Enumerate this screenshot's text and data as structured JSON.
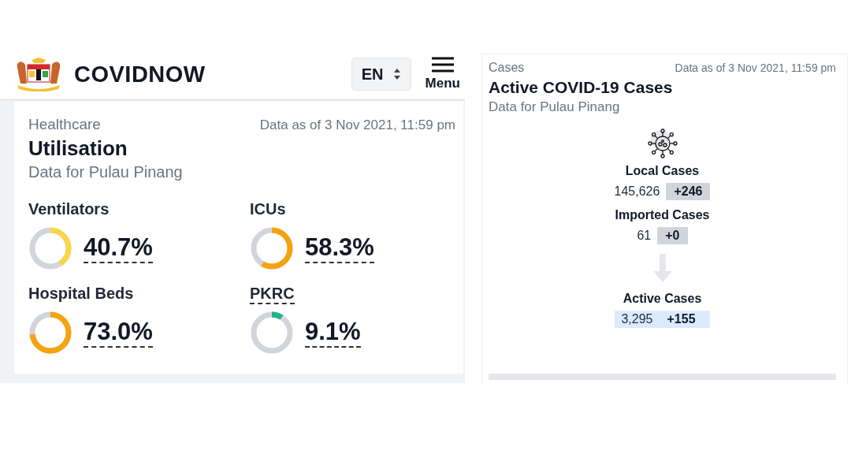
{
  "header": {
    "brand": "COVIDNOW",
    "language": "EN",
    "menu_label": "Menu"
  },
  "utilisation": {
    "category": "Healthcare",
    "timestamp": "Data as of 3 Nov 2021, 11:59 pm",
    "title": "Utilisation",
    "subtitle": "Data for Pulau Pinang",
    "metrics": [
      {
        "label": "Ventilators",
        "value": "40.7%",
        "level": 0.407,
        "color": "#fad54a",
        "label_underlined": false
      },
      {
        "label": "ICUs",
        "value": "58.3%",
        "level": 0.583,
        "color": "#f5a30f",
        "label_underlined": false
      },
      {
        "label": "Hospital Beds",
        "value": "73.0%",
        "level": 0.73,
        "color": "#f5a30f",
        "label_underlined": false
      },
      {
        "label": "PKRC",
        "value": "9.1%",
        "level": 0.091,
        "color": "#1fb586",
        "label_underlined": true
      }
    ]
  },
  "cases": {
    "category": "Cases",
    "timestamp": "Data as of 3 Nov 2021, 11:59 pm",
    "title": "Active COVID-19 Cases",
    "subtitle": "Data for Pulau Pinang",
    "flow": [
      {
        "kind": "stat",
        "label": "Local Cases",
        "total": "145,626",
        "change": "+246"
      },
      {
        "kind": "stat",
        "label": "Imported Cases",
        "total": "61",
        "change": "+0"
      },
      {
        "kind": "arrow"
      },
      {
        "kind": "result",
        "label": "Active Cases",
        "total": "3,295",
        "change": "+155"
      }
    ]
  }
}
